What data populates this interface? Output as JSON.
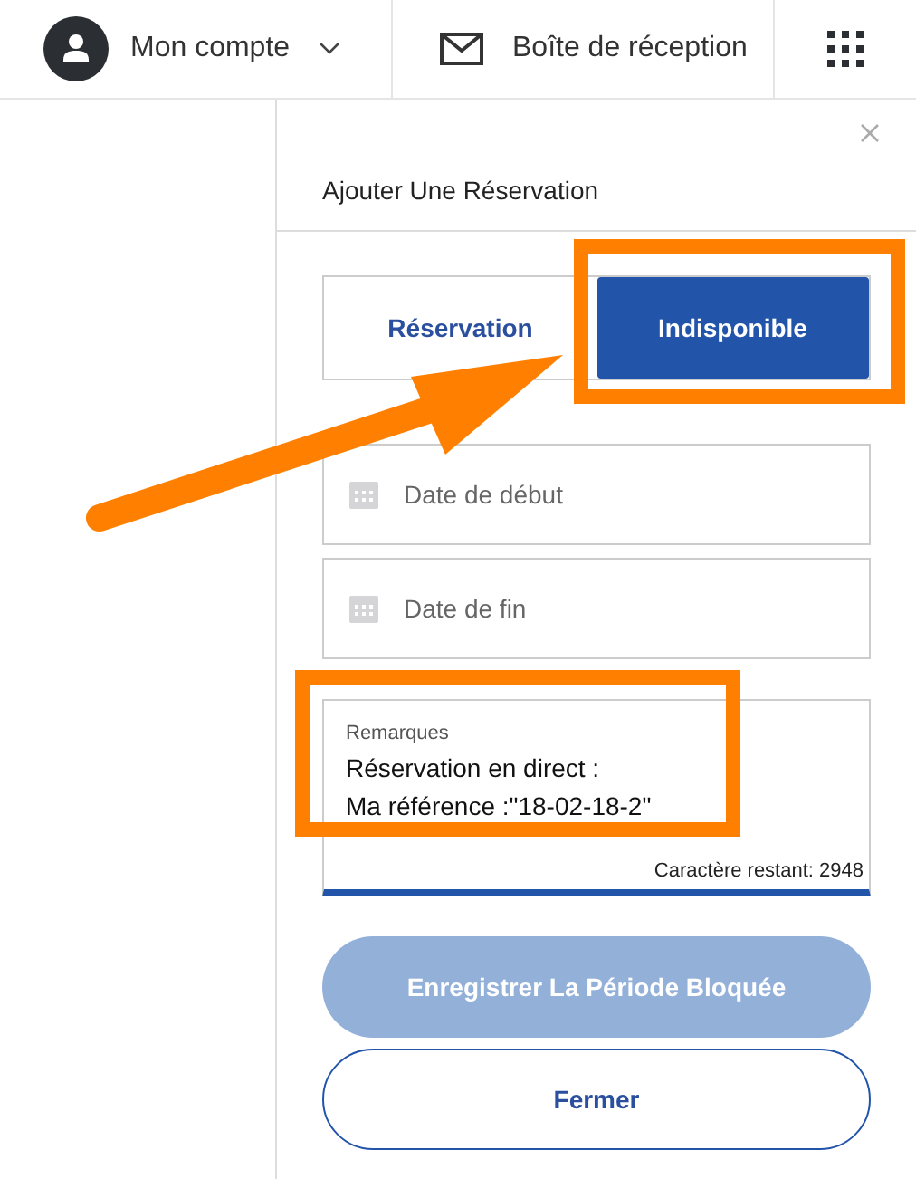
{
  "header": {
    "account": {
      "label": "Mon compte"
    },
    "inbox": {
      "label": "Boîte de réception"
    }
  },
  "panel": {
    "title": "Ajouter Une Réservation",
    "modes": [
      {
        "label": "Réservation",
        "selected": false
      },
      {
        "label": "Indisponible",
        "selected": true
      }
    ],
    "date_fields": [
      {
        "placeholder": "Date de début"
      },
      {
        "placeholder": "Date de fin"
      }
    ],
    "remarks": {
      "label": "Remarques",
      "lines": [
        "Réservation en direct :",
        "Ma référence :\"18-02-18-2\""
      ],
      "counter": "Caractère restant: 2948"
    },
    "save_button": {
      "label": "Enregistrer La Période Bloquée",
      "disabled": true
    },
    "close_button": {
      "label": "Fermer"
    }
  }
}
